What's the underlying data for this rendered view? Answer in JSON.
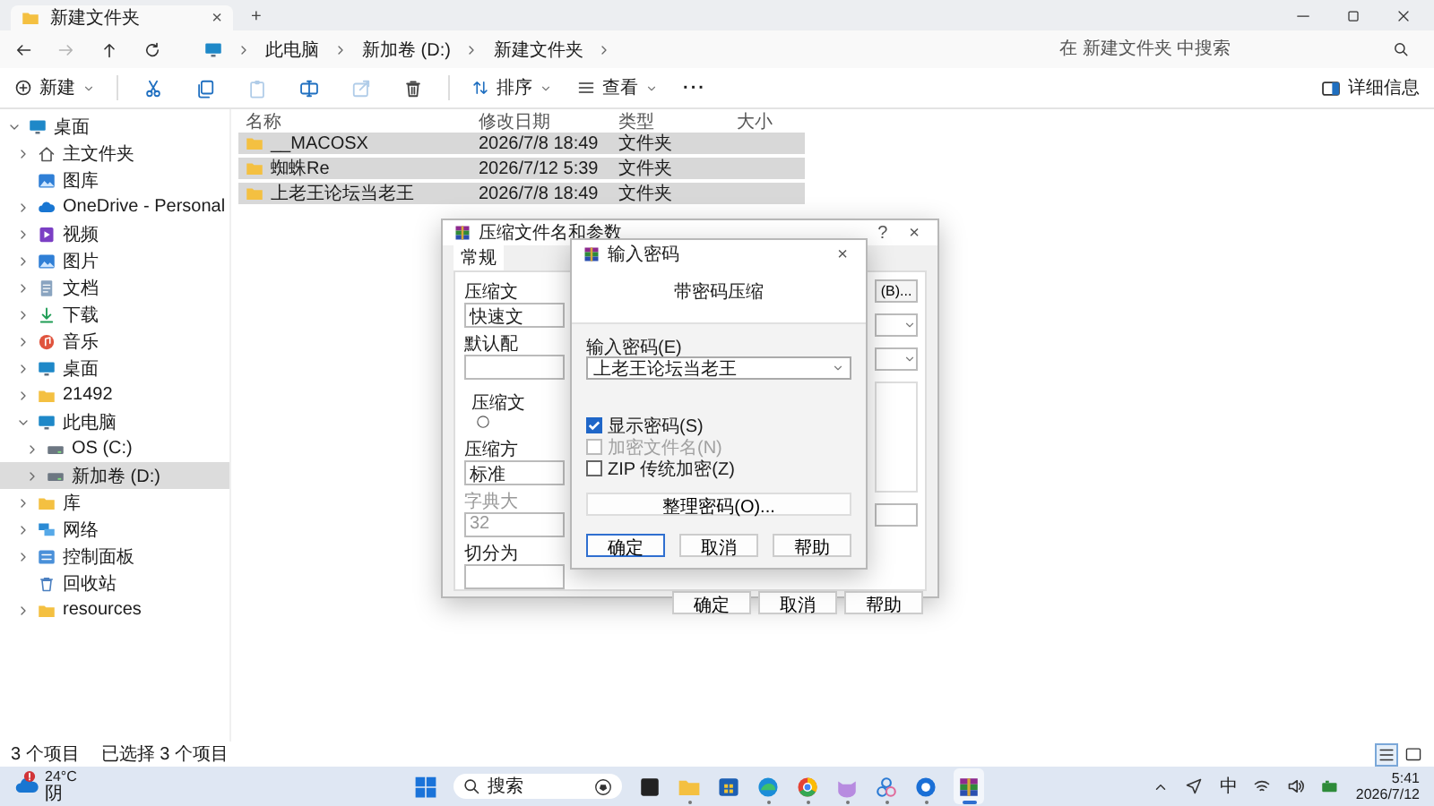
{
  "explorer": {
    "tab": {
      "title": "新建文件夹",
      "close": "×"
    },
    "new_tab": "+",
    "nav": [
      {
        "kind": "back",
        "disabled": false
      },
      {
        "kind": "forward",
        "disabled": true
      },
      {
        "kind": "up",
        "disabled": false
      },
      {
        "kind": "refresh",
        "disabled": false
      }
    ],
    "breadcrumbs": [
      "此电脑",
      "新加卷 (D:)",
      "新建文件夹"
    ],
    "search": {
      "placeholder": "在 新建文件夹 中搜索"
    },
    "toolbar": {
      "new_label": "新建",
      "actions": [
        {
          "kind": "cut",
          "disabled": false
        },
        {
          "kind": "copy",
          "disabled": false
        },
        {
          "kind": "paste",
          "disabled": true
        },
        {
          "kind": "rename",
          "disabled": false
        },
        {
          "kind": "share",
          "disabled": true
        },
        {
          "kind": "trash",
          "disabled": false
        }
      ],
      "sort_label": "排序",
      "view_label": "查看",
      "more": "···",
      "details_label": "详细信息"
    },
    "sidebar": {
      "items": [
        {
          "label": "桌面",
          "kind": "desktop",
          "expandable": true,
          "expanded": true,
          "selected": false,
          "children": [
            {
              "label": "主文件夹",
              "kind": "home",
              "expandable": true,
              "expanded": false,
              "selected": false
            },
            {
              "label": "图库",
              "kind": "picture",
              "expandable": false,
              "selected": false
            },
            {
              "label": "OneDrive - Personal",
              "kind": "cloud",
              "expandable": true,
              "expanded": false,
              "selected": false
            },
            {
              "label": "视频",
              "kind": "video",
              "expandable": true,
              "expanded": false,
              "selected": false
            },
            {
              "label": "图片",
              "kind": "picture",
              "expandable": true,
              "expanded": false,
              "selected": false
            },
            {
              "label": "文档",
              "kind": "document",
              "expandable": true,
              "expanded": false,
              "selected": false
            },
            {
              "label": "下载",
              "kind": "download",
              "expandable": true,
              "expanded": false,
              "selected": false
            },
            {
              "label": "音乐",
              "kind": "music",
              "expandable": true,
              "expanded": false,
              "selected": false
            },
            {
              "label": "桌面",
              "kind": "desktop",
              "expandable": true,
              "expanded": false,
              "selected": false
            },
            {
              "label": "21492",
              "kind": "folder",
              "expandable": true,
              "expanded": false,
              "selected": false
            },
            {
              "label": "此电脑",
              "kind": "desktop",
              "expandable": true,
              "expanded": true,
              "selected": false,
              "children": [
                {
                  "label": "OS (C:)",
                  "kind": "drive",
                  "expandable": true,
                  "expanded": false,
                  "selected": false
                },
                {
                  "label": "新加卷 (D:)",
                  "kind": "drive",
                  "expandable": true,
                  "expanded": false,
                  "selected": true
                }
              ]
            },
            {
              "label": "库",
              "kind": "folder",
              "expandable": true,
              "expanded": false,
              "selected": false
            },
            {
              "label": "网络",
              "kind": "network",
              "expandable": true,
              "expanded": false,
              "selected": false
            },
            {
              "label": "控制面板",
              "kind": "control",
              "expandable": true,
              "expanded": false,
              "selected": false
            },
            {
              "label": "回收站",
              "kind": "recycle",
              "expandable": false,
              "selected": false
            },
            {
              "label": "resources",
              "kind": "folder",
              "expandable": true,
              "expanded": false,
              "selected": false
            }
          ]
        }
      ]
    },
    "files": {
      "columns": [
        "名称",
        "修改日期",
        "类型",
        "大小"
      ],
      "rows": [
        {
          "name": "__MACOSX",
          "modified": "2026/7/8 18:49",
          "type": "文件夹",
          "selected": true
        },
        {
          "name": "蜘蛛Re",
          "modified": "2026/7/12 5:39",
          "type": "文件夹",
          "selected": true
        },
        {
          "name": "上老王论坛当老王",
          "modified": "2026/7/8 18:49",
          "type": "文件夹",
          "selected": true
        }
      ]
    },
    "status_bar": {
      "count": "3 个项目",
      "selection": "已选择 3 个项目",
      "views": [
        {
          "kind": "details",
          "selected": true
        },
        {
          "kind": "tiles",
          "selected": false
        }
      ]
    }
  },
  "archive_dialog": {
    "title": "压缩文件名和参数",
    "help": "?",
    "close": "×",
    "tab": "常规",
    "browse": "(B)...",
    "left_items": [
      {
        "kind": "label",
        "text": "压缩文"
      },
      {
        "kind": "field",
        "text": "快速文"
      },
      {
        "kind": "label",
        "text": "默认配"
      },
      {
        "kind": "field"
      },
      {
        "kind": "group_label",
        "text": "压缩文"
      },
      {
        "kind": "radio"
      },
      {
        "kind": "label",
        "text": "压缩方"
      },
      {
        "kind": "field",
        "text": "标准"
      },
      {
        "kind": "muted_label",
        "text": "字典大"
      },
      {
        "kind": "muted_field",
        "text": "32"
      },
      {
        "kind": "label",
        "text": "切分为"
      },
      {
        "kind": "field"
      }
    ],
    "buttons": [
      "确定",
      "取消",
      "帮助"
    ]
  },
  "password_dialog": {
    "title": "输入密码",
    "close": "×",
    "subtitle": "带密码压缩",
    "field_label": "输入密码(E)",
    "value": "上老王论坛当老王",
    "options": [
      {
        "label": "显示密码(S)",
        "checked": true,
        "disabled": false
      },
      {
        "label": "加密文件名(N)",
        "checked": false,
        "disabled": true
      },
      {
        "label": "ZIP 传统加密(Z)",
        "checked": false,
        "disabled": false
      }
    ],
    "manage": "整理密码(O)...",
    "buttons": [
      {
        "label": "确定",
        "default": true
      },
      {
        "label": "取消",
        "default": false
      },
      {
        "label": "帮助",
        "default": false
      }
    ]
  },
  "taskbar": {
    "temperature": "24°C",
    "condition": "阴",
    "search": "搜索",
    "apps": [
      {
        "kind": "taskview",
        "running": false,
        "active": false
      },
      {
        "kind": "folder",
        "running": true,
        "active": false
      },
      {
        "kind": "store",
        "running": false,
        "active": false
      },
      {
        "kind": "wave",
        "running": true,
        "active": false
      },
      {
        "kind": "tricircle",
        "running": true,
        "active": false
      },
      {
        "kind": "cat",
        "running": true,
        "active": false
      },
      {
        "kind": "rings",
        "running": true,
        "active": false
      },
      {
        "kind": "chat",
        "running": true,
        "active": false
      },
      {
        "kind": "books",
        "active": true
      }
    ],
    "ime": "中",
    "time": "5:41",
    "date": "2026/7/12"
  }
}
